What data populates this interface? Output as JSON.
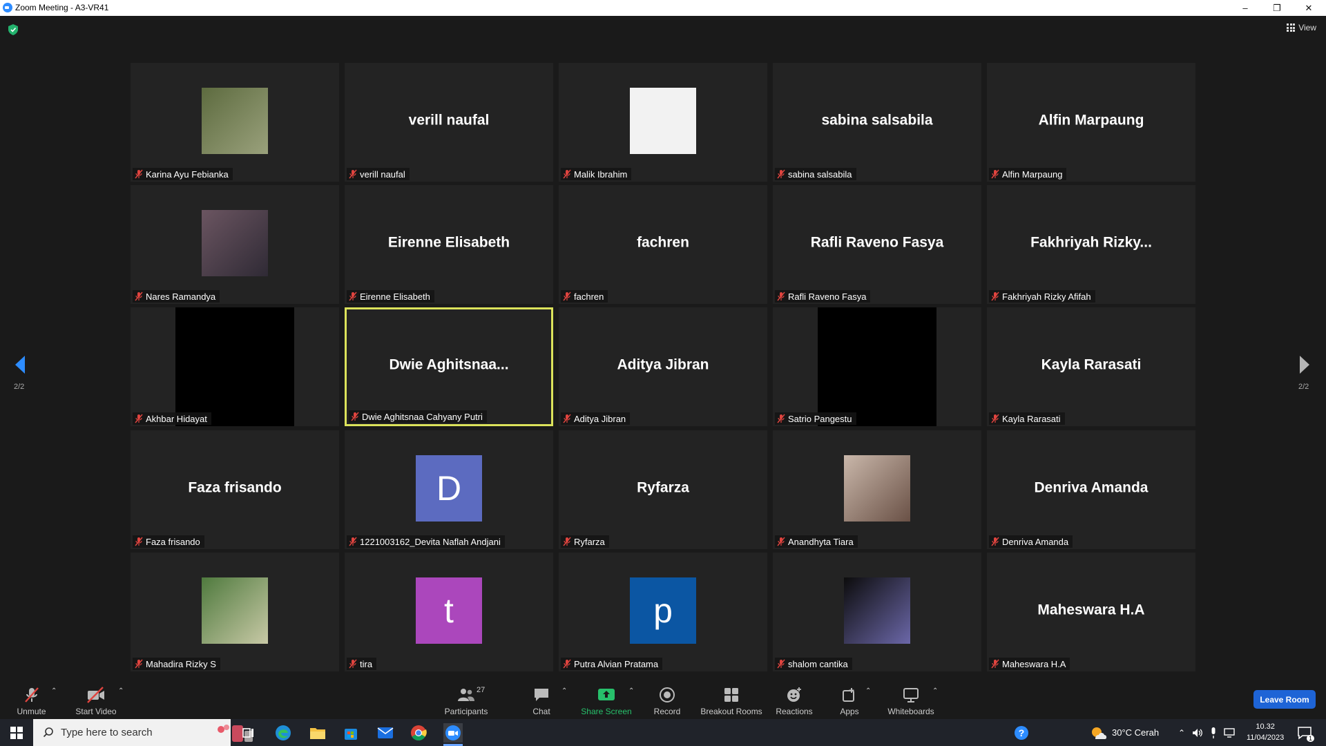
{
  "window": {
    "title": "Zoom Meeting - A3-VR41",
    "controls": [
      "minimize",
      "restore",
      "close"
    ]
  },
  "header": {
    "view_label": "View"
  },
  "pager": {
    "page_label_left": "2/2",
    "page_label_right": "2/2"
  },
  "tiles": [
    {
      "name": "Karina Ayu Febianka",
      "display": "photo",
      "colors": [
        "#5d6b3f",
        "#9aa17c"
      ]
    },
    {
      "name": "verill naufal",
      "display": "name",
      "big": "verill naufal"
    },
    {
      "name": "Malik Ibrahim",
      "display": "white"
    },
    {
      "name": "sabina salsabila",
      "display": "name",
      "big": "sabina salsabila"
    },
    {
      "name": "Alfin Marpaung",
      "display": "name",
      "big": "Alfin Marpaung"
    },
    {
      "name": "Nares Ramandya",
      "display": "photo",
      "colors": [
        "#6b5561",
        "#2f2a35"
      ]
    },
    {
      "name": "Eirenne Elisabeth",
      "display": "name",
      "big": "Eirenne Elisabeth"
    },
    {
      "name": "fachren",
      "display": "name",
      "big": "fachren"
    },
    {
      "name": "Rafli Raveno Fasya",
      "display": "name",
      "big": "Rafli Raveno Fasya"
    },
    {
      "name": "Fakhriyah Rizky Afifah",
      "display": "name",
      "big": "Fakhriyah  Rizky..."
    },
    {
      "name": "Akhbar Hidayat",
      "display": "black"
    },
    {
      "name": "Dwie Aghitsnaa Cahyany Putri",
      "display": "name",
      "big": "Dwie  Aghitsnaa...",
      "active": true
    },
    {
      "name": "Aditya Jibran",
      "display": "name",
      "big": "Aditya Jibran"
    },
    {
      "name": "Satrio Pangestu",
      "display": "black"
    },
    {
      "name": "Kayla Rarasati",
      "display": "name",
      "big": "Kayla Rarasati"
    },
    {
      "name": "Faza frisando",
      "display": "name",
      "big": "Faza frisando"
    },
    {
      "name": "1221003162_Devita Naflah Andjani",
      "display": "letter",
      "letter": "D",
      "color": "#5c6bc0"
    },
    {
      "name": "Ryfarza",
      "display": "name",
      "big": "Ryfarza"
    },
    {
      "name": "Anandhyta Tiara",
      "display": "photo",
      "colors": [
        "#c9b7aa",
        "#6a5146"
      ]
    },
    {
      "name": "Denriva Amanda",
      "display": "name",
      "big": "Denriva Amanda"
    },
    {
      "name": "Mahadira Rizky S",
      "display": "photo",
      "colors": [
        "#4f7a3e",
        "#c8c9a6"
      ]
    },
    {
      "name": "tira",
      "display": "letter",
      "letter": "t",
      "color": "#ab47bc"
    },
    {
      "name": "Putra Alvian Pratama",
      "display": "letter",
      "letter": "p",
      "color": "#0b56a3"
    },
    {
      "name": "shalom cantika",
      "display": "photo",
      "colors": [
        "#0c0c0c",
        "#6b67a8"
      ]
    },
    {
      "name": "Maheswara H.A",
      "display": "name",
      "big": "Maheswara H.A"
    }
  ],
  "toolbar": {
    "unmute": "Unmute",
    "start_video": "Start Video",
    "participants": "Participants",
    "participants_count": "27",
    "chat": "Chat",
    "share_screen": "Share Screen",
    "record": "Record",
    "breakout_rooms": "Breakout Rooms",
    "reactions": "Reactions",
    "apps": "Apps",
    "whiteboards": "Whiteboards",
    "leave_room": "Leave Room"
  },
  "taskbar": {
    "search_placeholder": "Type here to search",
    "weather": "30°C  Cerah",
    "time": "10.32",
    "date": "11/04/2023",
    "notifications": "1"
  },
  "colors": {
    "accent_blue": "#1e64d6",
    "active_speaker_border": "#dce35b",
    "share_green": "#27c06b",
    "muted_red": "#e0443f"
  }
}
